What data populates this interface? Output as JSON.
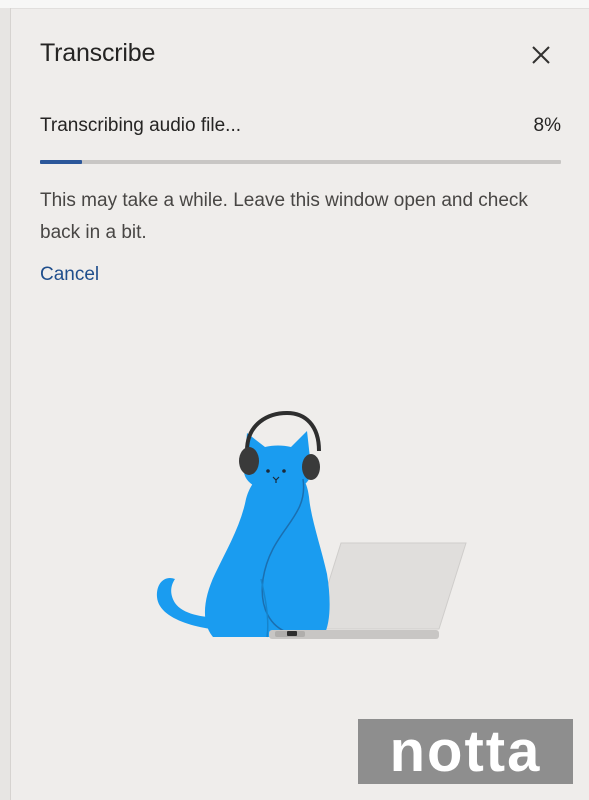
{
  "panel": {
    "title": "Transcribe",
    "close_icon": "close-icon"
  },
  "status": {
    "label": "Transcribing audio file...",
    "percent_text": "8%",
    "progress_fraction": 0.08
  },
  "description": "This may take a while. Leave this window open and check back in a bit.",
  "cancel_label": "Cancel",
  "illustration": {
    "name": "cat-with-headphones-laptop-illustration"
  },
  "watermark": {
    "text": "notta"
  },
  "colors": {
    "background": "#efedeb",
    "progress_fill": "#2b579a",
    "progress_track": "#c8c6c4",
    "link": "#1f4e8c",
    "cat": "#1a9cf0"
  }
}
